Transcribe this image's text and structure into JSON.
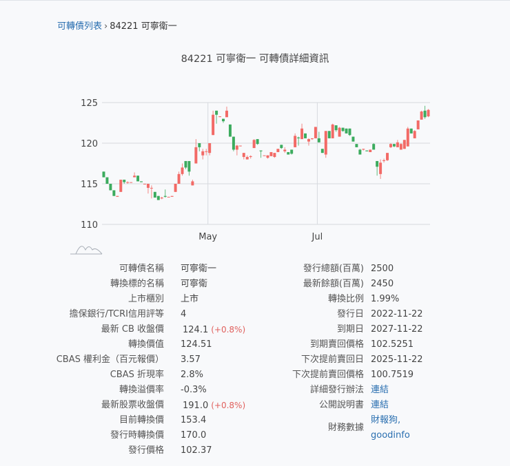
{
  "breadcrumb": {
    "list_link": "可轉債列表",
    "separator": "›",
    "current": "84221 可寧衛一"
  },
  "title": "84221 可寧衛一 可轉債詳細資訊",
  "colors": {
    "up": "#f26a66",
    "down": "#3cab5e",
    "link": "#2a6fb0"
  },
  "chart_data": {
    "type": "candlestick",
    "ylim": [
      110,
      125
    ],
    "yticks": [
      "110",
      "115",
      "120",
      "125"
    ],
    "xticks": [
      {
        "label": "May",
        "index": 31
      },
      {
        "label": "Jul",
        "index": 63
      }
    ],
    "ohlc": [
      [
        116.5,
        116.5,
        115.8,
        115.8
      ],
      [
        115.8,
        115.8,
        115,
        115
      ],
      [
        115,
        115,
        114.2,
        114.2
      ],
      [
        114.2,
        114.2,
        113.5,
        113.5
      ],
      [
        113.4,
        113.5,
        113.4,
        113.5
      ],
      [
        114,
        115.5,
        114,
        115.5
      ],
      [
        115.5,
        115.5,
        115,
        115.2
      ],
      [
        115.2,
        115.3,
        115,
        115.2
      ],
      [
        115.2,
        115.2,
        115.2,
        115.2
      ],
      [
        115.8,
        116.4,
        115.8,
        116
      ],
      [
        116,
        116,
        115.3,
        115.3
      ],
      [
        115.3,
        115.3,
        115.2,
        115.2
      ],
      [
        115,
        115,
        115,
        115
      ],
      [
        114.5,
        115,
        113.8,
        115
      ],
      [
        114.5,
        114.8,
        113.2,
        114.5
      ],
      [
        114,
        114,
        113.3,
        113.3
      ],
      [
        113.5,
        113.5,
        113,
        113
      ],
      [
        113.2,
        113.4,
        113.1,
        113.3
      ],
      [
        113.5,
        114.3,
        113.3,
        113.4
      ],
      [
        113.4,
        113.4,
        113.4,
        113.4
      ],
      [
        113.4,
        113.5,
        113.4,
        113.5
      ],
      [
        114,
        115,
        114,
        115
      ],
      [
        115,
        116.5,
        115,
        116.2
      ],
      [
        116.2,
        117.5,
        116,
        117
      ],
      [
        117.8,
        117.8,
        116.8,
        117
      ],
      [
        117.8,
        117.8,
        116,
        116.5
      ],
      [
        114.8,
        115.5,
        114.8,
        115.3
      ],
      [
        117.5,
        120.5,
        117.5,
        119.5
      ],
      [
        120,
        120,
        119,
        119.5
      ],
      [
        118.5,
        119.3,
        118,
        119
      ],
      [
        119,
        119.3,
        118.5,
        119
      ],
      [
        118.8,
        120,
        118.5,
        120
      ],
      [
        121,
        124,
        121,
        123.5
      ],
      [
        124,
        124,
        122.4,
        123.5
      ],
      [
        123.3,
        123.3,
        123.2,
        123.3
      ],
      [
        123,
        123,
        122.5,
        122.7
      ],
      [
        123.2,
        124.5,
        123.2,
        124
      ],
      [
        122.3,
        122.3,
        120.8,
        120.8
      ],
      [
        120.8,
        120.8,
        119,
        119.2
      ],
      [
        119.2,
        119.8,
        118.5,
        119.7
      ],
      [
        119.7,
        119.7,
        119.6,
        119.7
      ],
      [
        118.3,
        118.8,
        118,
        118.8
      ],
      [
        118,
        118.5,
        118,
        118.3
      ],
      [
        118.3,
        118.5,
        118.1,
        118.4
      ],
      [
        119.4,
        120.5,
        119.4,
        120.4
      ],
      [
        120.5,
        120.5,
        119.8,
        119.9
      ],
      [
        119.1,
        119.1,
        118.2,
        119
      ],
      [
        118.5,
        118.5,
        118.5,
        118.5
      ],
      [
        118.2,
        118.5,
        118.1,
        118.5
      ],
      [
        118.4,
        118.9,
        118.4,
        118.9
      ],
      [
        118.3,
        118.8,
        118.2,
        118.8
      ],
      [
        118.9,
        119.3,
        118.9,
        119.3
      ],
      [
        119.8,
        119.8,
        119.3,
        119.4
      ],
      [
        119,
        119.5,
        118.8,
        119.2
      ],
      [
        118.9,
        118.9,
        118.6,
        118.6
      ],
      [
        119.2,
        119.2,
        118.6,
        118.7
      ],
      [
        119.5,
        121.2,
        119.5,
        120.9
      ],
      [
        120.7,
        120.8,
        119.7,
        120.6
      ],
      [
        120.5,
        122.4,
        120.5,
        121.8
      ],
      [
        121.2,
        121.2,
        120.6,
        120.6
      ],
      [
        120.2,
        120.6,
        119.7,
        120.5
      ],
      [
        120.5,
        120.6,
        120.4,
        120.6
      ],
      [
        120.6,
        122,
        120.6,
        122
      ],
      [
        120.6,
        121.4,
        120.1,
        120.1
      ],
      [
        119.3,
        119.3,
        118.8,
        118.8
      ],
      [
        118.6,
        121.5,
        118.2,
        121.5
      ],
      [
        121.5,
        121.5,
        120.6,
        120.6
      ],
      [
        120.6,
        122.4,
        120.6,
        122.3
      ],
      [
        122.2,
        122.2,
        121.4,
        121.6
      ],
      [
        120.8,
        122,
        120.8,
        121.9
      ],
      [
        121.9,
        121.9,
        121.4,
        121.5
      ],
      [
        121.8,
        121.8,
        121.2,
        121.2
      ],
      [
        121.8,
        121.8,
        120.9,
        121
      ],
      [
        120.8,
        120.8,
        120.2,
        120.2
      ],
      [
        119.9,
        119.9,
        119.5,
        119.5
      ],
      [
        119.2,
        119.3,
        118.6,
        118.6
      ],
      [
        119.2,
        119.3,
        119.1,
        119.3
      ],
      [
        119.1,
        119.1,
        119,
        119
      ],
      [
        118.9,
        119.2,
        118.9,
        119.2
      ],
      [
        119.9,
        120,
        119.2,
        119.2
      ],
      [
        117.8,
        117.8,
        116,
        117.1
      ],
      [
        116.2,
        118,
        115.6,
        117.6
      ],
      [
        117.8,
        118.1,
        117.6,
        117.9
      ],
      [
        117.9,
        118.8,
        117.8,
        118.8
      ],
      [
        119.5,
        120,
        119.4,
        119.9
      ],
      [
        119.9,
        119.9,
        119.5,
        119.6
      ],
      [
        119.5,
        120.4,
        119.5,
        120.1
      ],
      [
        119.2,
        120,
        119.2,
        119.9
      ],
      [
        119.3,
        120.4,
        119.3,
        120.4
      ],
      [
        119.6,
        122,
        119.6,
        121.8
      ],
      [
        121.8,
        121.8,
        121.2,
        121.2
      ],
      [
        120.6,
        121.6,
        120.6,
        121.5
      ],
      [
        121.7,
        122.8,
        121.7,
        122.8
      ],
      [
        122.9,
        124,
        122.9,
        123.9
      ],
      [
        124,
        124.6,
        123,
        123.2
      ],
      [
        123.3,
        124.2,
        123.2,
        124.1
      ]
    ]
  },
  "left_table": [
    {
      "label": "可轉債名稱",
      "value": "可寧衛一"
    },
    {
      "label": "轉換標的名稱",
      "value": "可寧衛"
    },
    {
      "label": "上市櫃別",
      "value": "上市"
    },
    {
      "label": "擔保銀行/TCRI信用評等",
      "value": "4"
    },
    {
      "label": "最新 CB 收盤價",
      "value": "124.1",
      "change": "(+0.8%)"
    },
    {
      "label": "轉換價值",
      "value": "124.51"
    },
    {
      "label": "CBAS 權利金（百元報價）",
      "value": "3.57"
    },
    {
      "label": "CBAS 折現率",
      "value": "2.8%"
    },
    {
      "label": "轉換溢價率",
      "value": "-0.3%"
    },
    {
      "label": "最新股票收盤價",
      "value": "191.0",
      "change": "(+0.8%)"
    },
    {
      "label": "目前轉換價",
      "value": "153.4"
    },
    {
      "label": "發行時轉換價",
      "value": "170.0"
    },
    {
      "label": "發行價格",
      "value": "102.37"
    }
  ],
  "right_table": [
    {
      "label": "發行總額(百萬)",
      "value": "2500"
    },
    {
      "label": "最新餘額(百萬)",
      "value": "2450"
    },
    {
      "label": "轉換比例",
      "value": "1.99%"
    },
    {
      "label": "發行日",
      "value": "2022-11-22"
    },
    {
      "label": "到期日",
      "value": "2027-11-22"
    },
    {
      "label": "到期賣回價格",
      "value": "102.5251"
    },
    {
      "label": "下次提前賣回日",
      "value": "2025-11-22"
    },
    {
      "label": "下次提前賣回價格",
      "value": "100.7519"
    },
    {
      "label": "詳細發行辦法",
      "link": "連結"
    },
    {
      "label": "公開說明書",
      "link": "連結"
    },
    {
      "label": "財務數據",
      "links": [
        "財報狗,",
        "goodinfo"
      ]
    }
  ]
}
